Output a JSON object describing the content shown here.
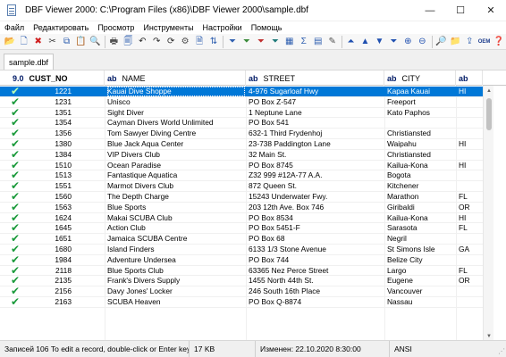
{
  "window": {
    "title": "DBF Viewer 2000: C:\\Program Files (x86)\\DBF Viewer 2000\\sample.dbf",
    "controls": {
      "minimize": "—",
      "maximize": "☐",
      "close": "✕"
    }
  },
  "menu": [
    "Файл",
    "Редактировать",
    "Просмотр",
    "Инструменты",
    "Настройки",
    "Помощь"
  ],
  "toolbar": [
    {
      "name": "open-folder-icon",
      "glyph": "📂",
      "color": "#d8a020"
    },
    {
      "name": "new-file-icon",
      "glyph": "🗋",
      "color": "#3060b0"
    },
    {
      "name": "delete-icon",
      "glyph": "✖",
      "color": "#d02020"
    },
    {
      "name": "cut-icon",
      "glyph": "✂",
      "color": "#404040"
    },
    {
      "name": "copy-icon",
      "glyph": "⧉",
      "color": "#3060b0"
    },
    {
      "name": "paste-icon",
      "glyph": "📋",
      "color": "#a07030"
    },
    {
      "name": "find-icon",
      "glyph": "🔍",
      "color": "#3060b0"
    },
    {
      "sep": true
    },
    {
      "name": "print-icon",
      "glyph": "🖶",
      "color": "#505050"
    },
    {
      "name": "preview-icon",
      "glyph": "🗐",
      "color": "#3060b0"
    },
    {
      "name": "undo-icon",
      "glyph": "↶",
      "color": "#303030"
    },
    {
      "name": "redo-icon",
      "glyph": "↷",
      "color": "#303030"
    },
    {
      "name": "refresh-icon",
      "glyph": "⟳",
      "color": "#303030"
    },
    {
      "name": "settings-icon",
      "glyph": "⚙",
      "color": "#505050"
    },
    {
      "name": "document-icon",
      "glyph": "🗎",
      "color": "#3060b0"
    },
    {
      "name": "sort-icon",
      "glyph": "⇅",
      "color": "#3060b0"
    },
    {
      "sep": true
    },
    {
      "name": "filter-icon",
      "glyph": "⏷",
      "color": "#3060b0"
    },
    {
      "name": "filter-add-icon",
      "glyph": "⏷",
      "color": "#3a8a3a"
    },
    {
      "name": "filter-remove-icon",
      "glyph": "⏷",
      "color": "#c03030"
    },
    {
      "name": "filter-edit-icon",
      "glyph": "⏷",
      "color": "#207a7a"
    },
    {
      "name": "table-icon",
      "glyph": "▦",
      "color": "#3060b0"
    },
    {
      "name": "sum-icon",
      "glyph": "Σ",
      "color": "#3060b0"
    },
    {
      "name": "structure-icon",
      "glyph": "▤",
      "color": "#3060b0"
    },
    {
      "name": "edit-icon",
      "glyph": "✎",
      "color": "#505050"
    },
    {
      "sep": true
    },
    {
      "name": "first-record-icon",
      "glyph": "⏶",
      "color": "#2050b0"
    },
    {
      "name": "prev-record-icon",
      "glyph": "▲",
      "color": "#2050b0"
    },
    {
      "name": "next-record-icon",
      "glyph": "▼",
      "color": "#2050b0"
    },
    {
      "name": "last-record-icon",
      "glyph": "⏷",
      "color": "#2050b0"
    },
    {
      "name": "append-record-icon",
      "glyph": "⊕",
      "color": "#2050b0"
    },
    {
      "name": "delete-record-icon",
      "glyph": "⊖",
      "color": "#2050b0"
    },
    {
      "sep": true
    },
    {
      "name": "search-records-icon",
      "glyph": "🔎",
      "color": "#3060b0"
    },
    {
      "name": "folder-icon",
      "glyph": "📁",
      "color": "#d8a020"
    },
    {
      "name": "export-icon",
      "glyph": "⇪",
      "color": "#3060b0"
    },
    {
      "name": "oem-icon",
      "glyph": "OEM",
      "color": "#1d3d8d"
    },
    {
      "name": "help-icon",
      "glyph": "❓",
      "color": "#3060b0"
    }
  ],
  "tab": "sample.dbf",
  "columns": [
    {
      "type": "9.0",
      "name": "CUST_NO"
    },
    {
      "type": "ab",
      "name": "NAME"
    },
    {
      "type": "ab",
      "name": "STREET"
    },
    {
      "type": "ab",
      "name": "CITY"
    },
    {
      "type": "ab",
      "name": ""
    }
  ],
  "rows": [
    {
      "no": "1221",
      "name": "Kauai Dive Shoppe",
      "street": "4-976 Sugarloaf Hwy",
      "city": "Kapaa Kauai",
      "st": "HI",
      "selected": true
    },
    {
      "no": "1231",
      "name": "Unisco",
      "street": "PO Box Z-547",
      "city": "Freeport",
      "st": ""
    },
    {
      "no": "1351",
      "name": "Sight Diver",
      "street": "1 Neptune Lane",
      "city": "Kato Paphos",
      "st": ""
    },
    {
      "no": "1354",
      "name": "Cayman Divers World Unlimited",
      "street": "PO Box 541",
      "city": "",
      "st": ""
    },
    {
      "no": "1356",
      "name": "Tom Sawyer Diving Centre",
      "street": "632-1 Third Frydenhoj",
      "city": "Christiansted",
      "st": ""
    },
    {
      "no": "1380",
      "name": "Blue Jack Aqua Center",
      "street": "23-738 Paddington Lane",
      "city": "Waipahu",
      "st": "HI"
    },
    {
      "no": "1384",
      "name": "VIP Divers Club",
      "street": "32 Main St.",
      "city": "Christiansted",
      "st": ""
    },
    {
      "no": "1510",
      "name": "Ocean Paradise",
      "street": "PO Box 8745",
      "city": "Kailua-Kona",
      "st": "HI"
    },
    {
      "no": "1513",
      "name": "Fantastique Aquatica",
      "street": "Z32 999 #12A-77 A.A.",
      "city": "Bogota",
      "st": ""
    },
    {
      "no": "1551",
      "name": "Marmot Divers Club",
      "street": "872 Queen St.",
      "city": "Kitchener",
      "st": ""
    },
    {
      "no": "1560",
      "name": "The Depth Charge",
      "street": "15243 Underwater Fwy.",
      "city": "Marathon",
      "st": "FL"
    },
    {
      "no": "1563",
      "name": "Blue Sports",
      "street": "203 12th Ave. Box 746",
      "city": "Giribaldi",
      "st": "OR"
    },
    {
      "no": "1624",
      "name": "Makai SCUBA Club",
      "street": "PO Box 8534",
      "city": "Kailua-Kona",
      "st": "HI"
    },
    {
      "no": "1645",
      "name": "Action Club",
      "street": "PO Box 5451-F",
      "city": "Sarasota",
      "st": "FL"
    },
    {
      "no": "1651",
      "name": "Jamaica SCUBA Centre",
      "street": "PO Box 68",
      "city": "Negril",
      "st": ""
    },
    {
      "no": "1680",
      "name": "Island Finders",
      "street": "6133 1/3 Stone Avenue",
      "city": "St Simons Isle",
      "st": "GA"
    },
    {
      "no": "1984",
      "name": "Adventure Undersea",
      "street": "PO Box 744",
      "city": "Belize City",
      "st": ""
    },
    {
      "no": "2118",
      "name": "Blue Sports Club",
      "street": "63365 Nez Perce Street",
      "city": "Largo",
      "st": "FL"
    },
    {
      "no": "2135",
      "name": "Frank's Divers Supply",
      "street": "1455 North 44th St.",
      "city": "Eugene",
      "st": "OR"
    },
    {
      "no": "2156",
      "name": "Davy Jones' Locker",
      "street": "246 South 16th Place",
      "city": "Vancouver",
      "st": ""
    },
    {
      "no": "2163",
      "name": "SCUBA Heaven",
      "street": "PO Box Q-8874",
      "city": "Nassau",
      "st": ""
    }
  ],
  "status": {
    "record": "Записей 106",
    "hint": "To edit a record, double-click or Enter key",
    "size": "17 KB",
    "modified": "Изменен: 22.10.2020 8:30:00",
    "encoding": "ANSI"
  }
}
